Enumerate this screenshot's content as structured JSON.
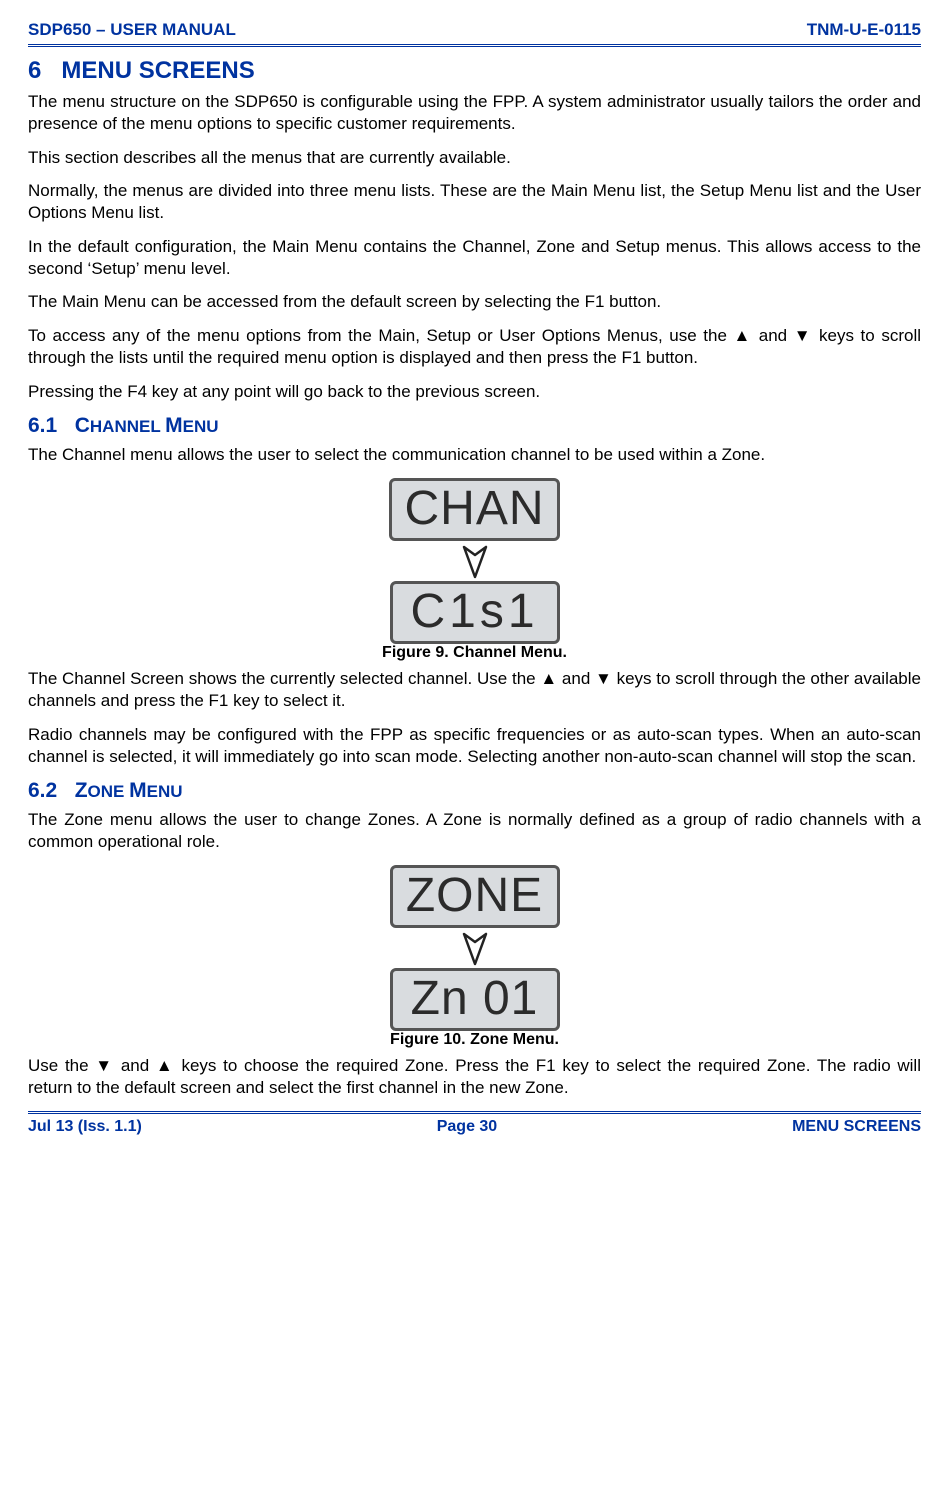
{
  "header": {
    "left": "SDP650 – USER MANUAL",
    "right": "TNM-U-E-0115"
  },
  "section6": {
    "number": "6",
    "title": "MENU SCREENS",
    "p1": "The menu structure on the SDP650 is configurable using the FPP.  A system administrator usually tailors the order and presence of the menu options to specific customer requirements.",
    "p2": "This section describes all the menus that are currently available.",
    "p3": "Normally, the menus are divided into three menu lists.  These are the Main Menu list, the Setup Menu list and the User Options Menu list.",
    "p4": "In the default configuration, the Main Menu contains the Channel, Zone and Setup menus.  This allows access to the second ‘Setup’ menu level.",
    "p5": "The Main Menu can be accessed from the default screen by selecting the F1 button.",
    "p6": "To access any of the menu options from the Main, Setup or User Options Menus, use the ▲ and ▼ keys to scroll through the lists until the required menu option is displayed and then press the F1 button.",
    "p7": "Pressing the F4 key at any point will go back to the previous screen."
  },
  "section61": {
    "number": "6.1",
    "firstCap": "C",
    "rest1": "HANNEL ",
    "firstCap2": "M",
    "rest2": "ENU",
    "p1": "The Channel menu allows the user to select the communication channel to be used within a Zone.",
    "lcd_top": "CHAN",
    "lcd_bottom": "C1s1",
    "fig_caption": "Figure 9.  Channel Menu.",
    "p2": "The Channel Screen shows the currently selected channel.  Use the ▲ and ▼ keys to scroll through the other available channels and press the F1 key to select it.",
    "p3": "Radio channels may be configured with the FPP as specific frequencies or as auto-scan types.  When an auto-scan channel is selected, it will immediately go into scan mode.  Selecting another non-auto-scan channel will stop the scan."
  },
  "section62": {
    "number": "6.2",
    "firstCap": "Z",
    "rest1": "ONE ",
    "firstCap2": "M",
    "rest2": "ENU",
    "p1": "The Zone menu allows the user to change Zones.  A Zone is normally defined as a group of radio channels with a common operational role.",
    "lcd_top": "ZONE",
    "lcd_bottom": "Zn 01",
    "fig_caption": "Figure 10.  Zone Menu.",
    "p2": "Use the ▼ and ▲ keys to choose the required Zone.  Press the F1 key to select the required Zone.  The radio will return to the default screen and select the first channel in the new Zone."
  },
  "footer": {
    "left": "Jul 13 (Iss. 1.1)",
    "center": "Page 30",
    "right": "MENU SCREENS"
  }
}
